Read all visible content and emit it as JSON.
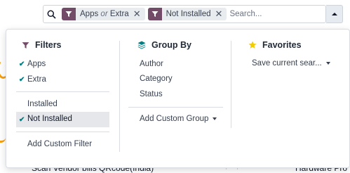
{
  "search": {
    "facets": [
      {
        "icon": "filter-icon",
        "values": [
          "Apps",
          "Extra"
        ],
        "separator": "or"
      },
      {
        "icon": "filter-icon",
        "values": [
          "Not Installed"
        ],
        "separator": ""
      }
    ],
    "placeholder": "Search..."
  },
  "filters": {
    "title": "Filters",
    "group1": [
      {
        "label": "Apps",
        "checked": true
      },
      {
        "label": "Extra",
        "checked": true
      }
    ],
    "group2": [
      {
        "label": "Installed",
        "checked": false
      },
      {
        "label": "Not Installed",
        "checked": true
      }
    ],
    "custom": "Add Custom Filter"
  },
  "group_by": {
    "title": "Group By",
    "items": [
      "Author",
      "Category",
      "Status"
    ],
    "custom": "Add Custom Group"
  },
  "favorites": {
    "title": "Favorites",
    "save": "Save current sear..."
  },
  "background": {
    "bottom_left": "Scan Vendor bills QRcode(India)",
    "bottom_right": "Hardware Pro",
    "right_frag1": "ec",
    "right_frag2": "n"
  },
  "colors": {
    "accent": "#714b67",
    "check": "#017e84",
    "star": "#f3cc00",
    "layers": "#017e84"
  }
}
